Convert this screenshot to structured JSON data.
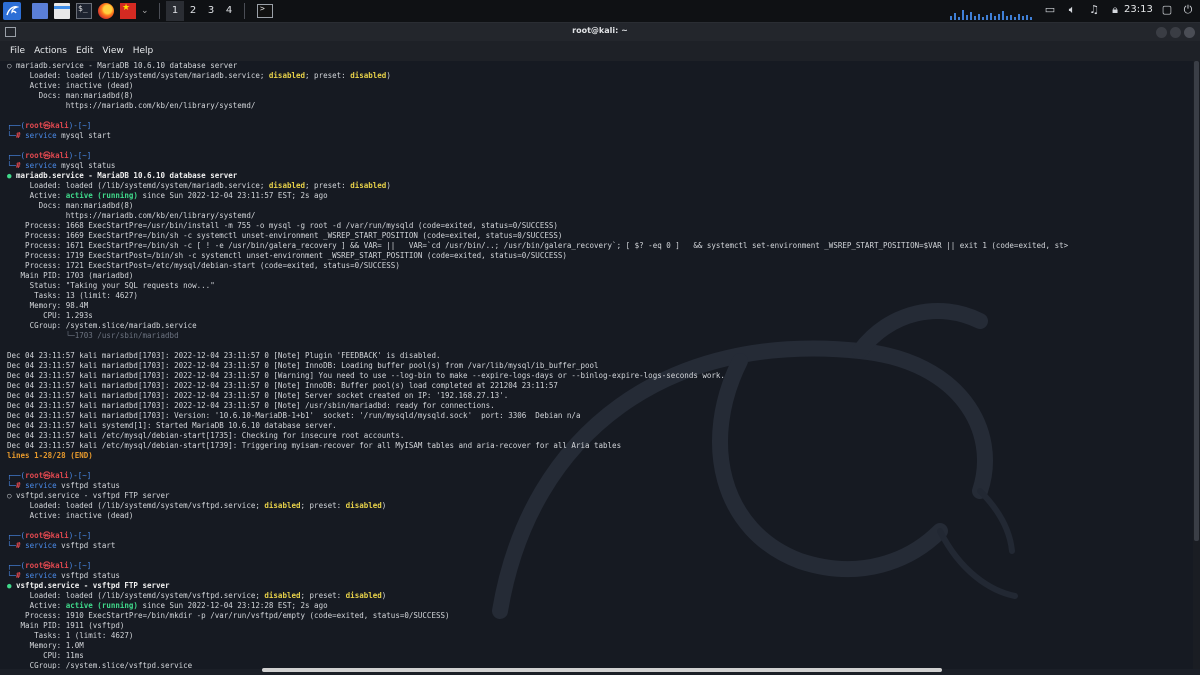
{
  "panel": {
    "workspaces": [
      "1",
      "2",
      "3",
      "4"
    ],
    "active_workspace": "1",
    "clock": "23:13",
    "icons": [
      "kali-menu-icon",
      "desktop-icon",
      "files-icon",
      "terminal-icon",
      "firefox-icon",
      "red-app-icon",
      "chevron-down-icon",
      "terminal-task-icon",
      "monitor-icon",
      "volume-icon",
      "notifications-icon",
      "lock-icon",
      "power-icon"
    ]
  },
  "window": {
    "title": "root@kali: ~",
    "menu": [
      "File",
      "Actions",
      "Edit",
      "View",
      "Help"
    ]
  },
  "colors": {
    "prompt_red": "#e0484f",
    "prompt_blue": "#4a8bea",
    "active_green": "#3fd98a",
    "disabled_yellow": "#e8d24a",
    "lines_orange": "#e89a2c",
    "panel_bg": "#0f1114",
    "terminal_bg": "#161a22"
  },
  "terminal": {
    "lines": [
      [
        [
          "",
          "○ mariadb.service - MariaDB 10.6.10 database server"
        ]
      ],
      [
        [
          "",
          "     Loaded: loaded (/lib/systemd/system/mariadb.service; "
        ],
        [
          "yellow",
          "disabled"
        ],
        [
          "",
          "; preset: "
        ],
        [
          "yellow",
          "disabled"
        ],
        [
          "",
          ")"
        ]
      ],
      [
        [
          "",
          "     Active: inactive (dead)"
        ]
      ],
      [
        [
          "",
          "       Docs: man:mariadbd(8)"
        ]
      ],
      [
        [
          "",
          "             https://mariadb.com/kb/en/library/systemd/"
        ]
      ],
      [
        [
          "",
          ""
        ]
      ],
      [
        [
          "blue",
          "┌──("
        ],
        [
          "red",
          "root㉿kali"
        ],
        [
          "blue",
          ")-[~]"
        ]
      ],
      [
        [
          "blue",
          "└─"
        ],
        [
          "red",
          "#"
        ],
        [
          "",
          " "
        ],
        [
          "blue",
          "service"
        ],
        [
          "",
          " mysql start"
        ]
      ],
      [
        [
          "",
          ""
        ]
      ],
      [
        [
          "blue",
          "┌──("
        ],
        [
          "red",
          "root㉿kali"
        ],
        [
          "blue",
          ")-[~]"
        ]
      ],
      [
        [
          "blue",
          "└─"
        ],
        [
          "red",
          "#"
        ],
        [
          "",
          " "
        ],
        [
          "blue",
          "service"
        ],
        [
          "",
          " mysql status"
        ]
      ],
      [
        [
          "green",
          "●"
        ],
        [
          "white",
          " mariadb.service - MariaDB 10.6.10 database server"
        ]
      ],
      [
        [
          "",
          "     Loaded: loaded (/lib/systemd/system/mariadb.service; "
        ],
        [
          "yellow",
          "disabled"
        ],
        [
          "",
          "; preset: "
        ],
        [
          "yellow",
          "disabled"
        ],
        [
          "",
          ")"
        ]
      ],
      [
        [
          "",
          "     Active: "
        ],
        [
          "green",
          "active (running)"
        ],
        [
          "",
          " since Sun 2022-12-04 23:11:57 EST; 2s ago"
        ]
      ],
      [
        [
          "",
          "       Docs: man:mariadbd(8)"
        ]
      ],
      [
        [
          "",
          "             https://mariadb.com/kb/en/library/systemd/"
        ]
      ],
      [
        [
          "",
          "    Process: 1668 ExecStartPre=/usr/bin/install -m 755 -o mysql -g root -d /var/run/mysqld (code=exited, status=0/SUCCESS)"
        ]
      ],
      [
        [
          "",
          "    Process: 1669 ExecStartPre=/bin/sh -c systemctl unset-environment _WSREP_START_POSITION (code=exited, status=0/SUCCESS)"
        ]
      ],
      [
        [
          "",
          "    Process: 1671 ExecStartPre=/bin/sh -c [ ! -e /usr/bin/galera_recovery ] && VAR= ||   VAR=`cd /usr/bin/..; /usr/bin/galera_recovery`; [ $? -eq 0 ]   && systemctl set-environment _WSREP_START_POSITION=$VAR || exit 1 (code=exited, st>"
        ]
      ],
      [
        [
          "",
          "    Process: 1719 ExecStartPost=/bin/sh -c systemctl unset-environment _WSREP_START_POSITION (code=exited, status=0/SUCCESS)"
        ]
      ],
      [
        [
          "",
          "    Process: 1721 ExecStartPost=/etc/mysql/debian-start (code=exited, status=0/SUCCESS)"
        ]
      ],
      [
        [
          "",
          "   Main PID: 1703 (mariadbd)"
        ]
      ],
      [
        [
          "",
          "     Status: \"Taking your SQL requests now...\""
        ]
      ],
      [
        [
          "",
          "      Tasks: 13 (limit: 4627)"
        ]
      ],
      [
        [
          "",
          "     Memory: 98.4M"
        ]
      ],
      [
        [
          "",
          "        CPU: 1.293s"
        ]
      ],
      [
        [
          "",
          "     CGroup: /system.slice/mariadb.service"
        ]
      ],
      [
        [
          "dim",
          "             └─1703 /usr/sbin/mariadbd"
        ]
      ],
      [
        [
          "",
          ""
        ]
      ],
      [
        [
          "",
          "Dec 04 23:11:57 kali mariadbd[1703]: 2022-12-04 23:11:57 0 [Note] Plugin 'FEEDBACK' is disabled."
        ]
      ],
      [
        [
          "",
          "Dec 04 23:11:57 kali mariadbd[1703]: 2022-12-04 23:11:57 0 [Note] InnoDB: Loading buffer pool(s) from /var/lib/mysql/ib_buffer_pool"
        ]
      ],
      [
        [
          "",
          "Dec 04 23:11:57 kali mariadbd[1703]: 2022-12-04 23:11:57 0 [Warning] You need to use --log-bin to make --expire-logs-days or --binlog-expire-logs-seconds work."
        ]
      ],
      [
        [
          "",
          "Dec 04 23:11:57 kali mariadbd[1703]: 2022-12-04 23:11:57 0 [Note] InnoDB: Buffer pool(s) load completed at 221204 23:11:57"
        ]
      ],
      [
        [
          "",
          "Dec 04 23:11:57 kali mariadbd[1703]: 2022-12-04 23:11:57 0 [Note] Server socket created on IP: '192.168.27.13'."
        ]
      ],
      [
        [
          "",
          "Dec 04 23:11:57 kali mariadbd[1703]: 2022-12-04 23:11:57 0 [Note] /usr/sbin/mariadbd: ready for connections."
        ]
      ],
      [
        [
          "",
          "Dec 04 23:11:57 kali mariadbd[1703]: Version: '10.6.10-MariaDB-1+b1'  socket: '/run/mysqld/mysqld.sock'  port: 3306  Debian n/a"
        ]
      ],
      [
        [
          "",
          "Dec 04 23:11:57 kali systemd[1]: Started MariaDB 10.6.10 database server."
        ]
      ],
      [
        [
          "",
          "Dec 04 23:11:57 kali /etc/mysql/debian-start[1735]: Checking for insecure root accounts."
        ]
      ],
      [
        [
          "",
          "Dec 04 23:11:57 kali /etc/mysql/debian-start[1739]: Triggering myisam-recover for all MyISAM tables and aria-recover for all Aria tables"
        ]
      ],
      [
        [
          "orange",
          "lines 1-28/28 (END)"
        ]
      ],
      [
        [
          "",
          ""
        ]
      ],
      [
        [
          "blue",
          "┌──("
        ],
        [
          "red",
          "root㉿kali"
        ],
        [
          "blue",
          ")-[~]"
        ]
      ],
      [
        [
          "blue",
          "└─"
        ],
        [
          "red",
          "#"
        ],
        [
          "",
          " "
        ],
        [
          "blue",
          "service"
        ],
        [
          "",
          " vsftpd status"
        ]
      ],
      [
        [
          "",
          "○ vsftpd.service - vsftpd FTP server"
        ]
      ],
      [
        [
          "",
          "     Loaded: loaded (/lib/systemd/system/vsftpd.service; "
        ],
        [
          "yellow",
          "disabled"
        ],
        [
          "",
          "; preset: "
        ],
        [
          "yellow",
          "disabled"
        ],
        [
          "",
          ")"
        ]
      ],
      [
        [
          "",
          "     Active: inactive (dead)"
        ]
      ],
      [
        [
          "",
          ""
        ]
      ],
      [
        [
          "blue",
          "┌──("
        ],
        [
          "red",
          "root㉿kali"
        ],
        [
          "blue",
          ")-[~]"
        ]
      ],
      [
        [
          "blue",
          "└─"
        ],
        [
          "red",
          "#"
        ],
        [
          "",
          " "
        ],
        [
          "blue",
          "service"
        ],
        [
          "",
          " vsftpd start"
        ]
      ],
      [
        [
          "",
          ""
        ]
      ],
      [
        [
          "blue",
          "┌──("
        ],
        [
          "red",
          "root㉿kali"
        ],
        [
          "blue",
          ")-[~]"
        ]
      ],
      [
        [
          "blue",
          "└─"
        ],
        [
          "red",
          "#"
        ],
        [
          "",
          " "
        ],
        [
          "blue",
          "service"
        ],
        [
          "",
          " vsftpd status"
        ]
      ],
      [
        [
          "green",
          "●"
        ],
        [
          "white",
          " vsftpd.service - vsftpd FTP server"
        ]
      ],
      [
        [
          "",
          "     Loaded: loaded (/lib/systemd/system/vsftpd.service; "
        ],
        [
          "yellow",
          "disabled"
        ],
        [
          "",
          "; preset: "
        ],
        [
          "yellow",
          "disabled"
        ],
        [
          "",
          ")"
        ]
      ],
      [
        [
          "",
          "     Active: "
        ],
        [
          "green",
          "active (running)"
        ],
        [
          "",
          " since Sun 2022-12-04 23:12:28 EST; 2s ago"
        ]
      ],
      [
        [
          "",
          "    Process: 1910 ExecStartPre=/bin/mkdir -p /var/run/vsftpd/empty (code=exited, status=0/SUCCESS)"
        ]
      ],
      [
        [
          "",
          "   Main PID: 1911 (vsftpd)"
        ]
      ],
      [
        [
          "",
          "      Tasks: 1 (limit: 4627)"
        ]
      ],
      [
        [
          "",
          "     Memory: 1.0M"
        ]
      ],
      [
        [
          "",
          "        CPU: 11ms"
        ]
      ],
      [
        [
          "",
          "     CGroup: /system.slice/vsftpd.service"
        ]
      ]
    ]
  }
}
